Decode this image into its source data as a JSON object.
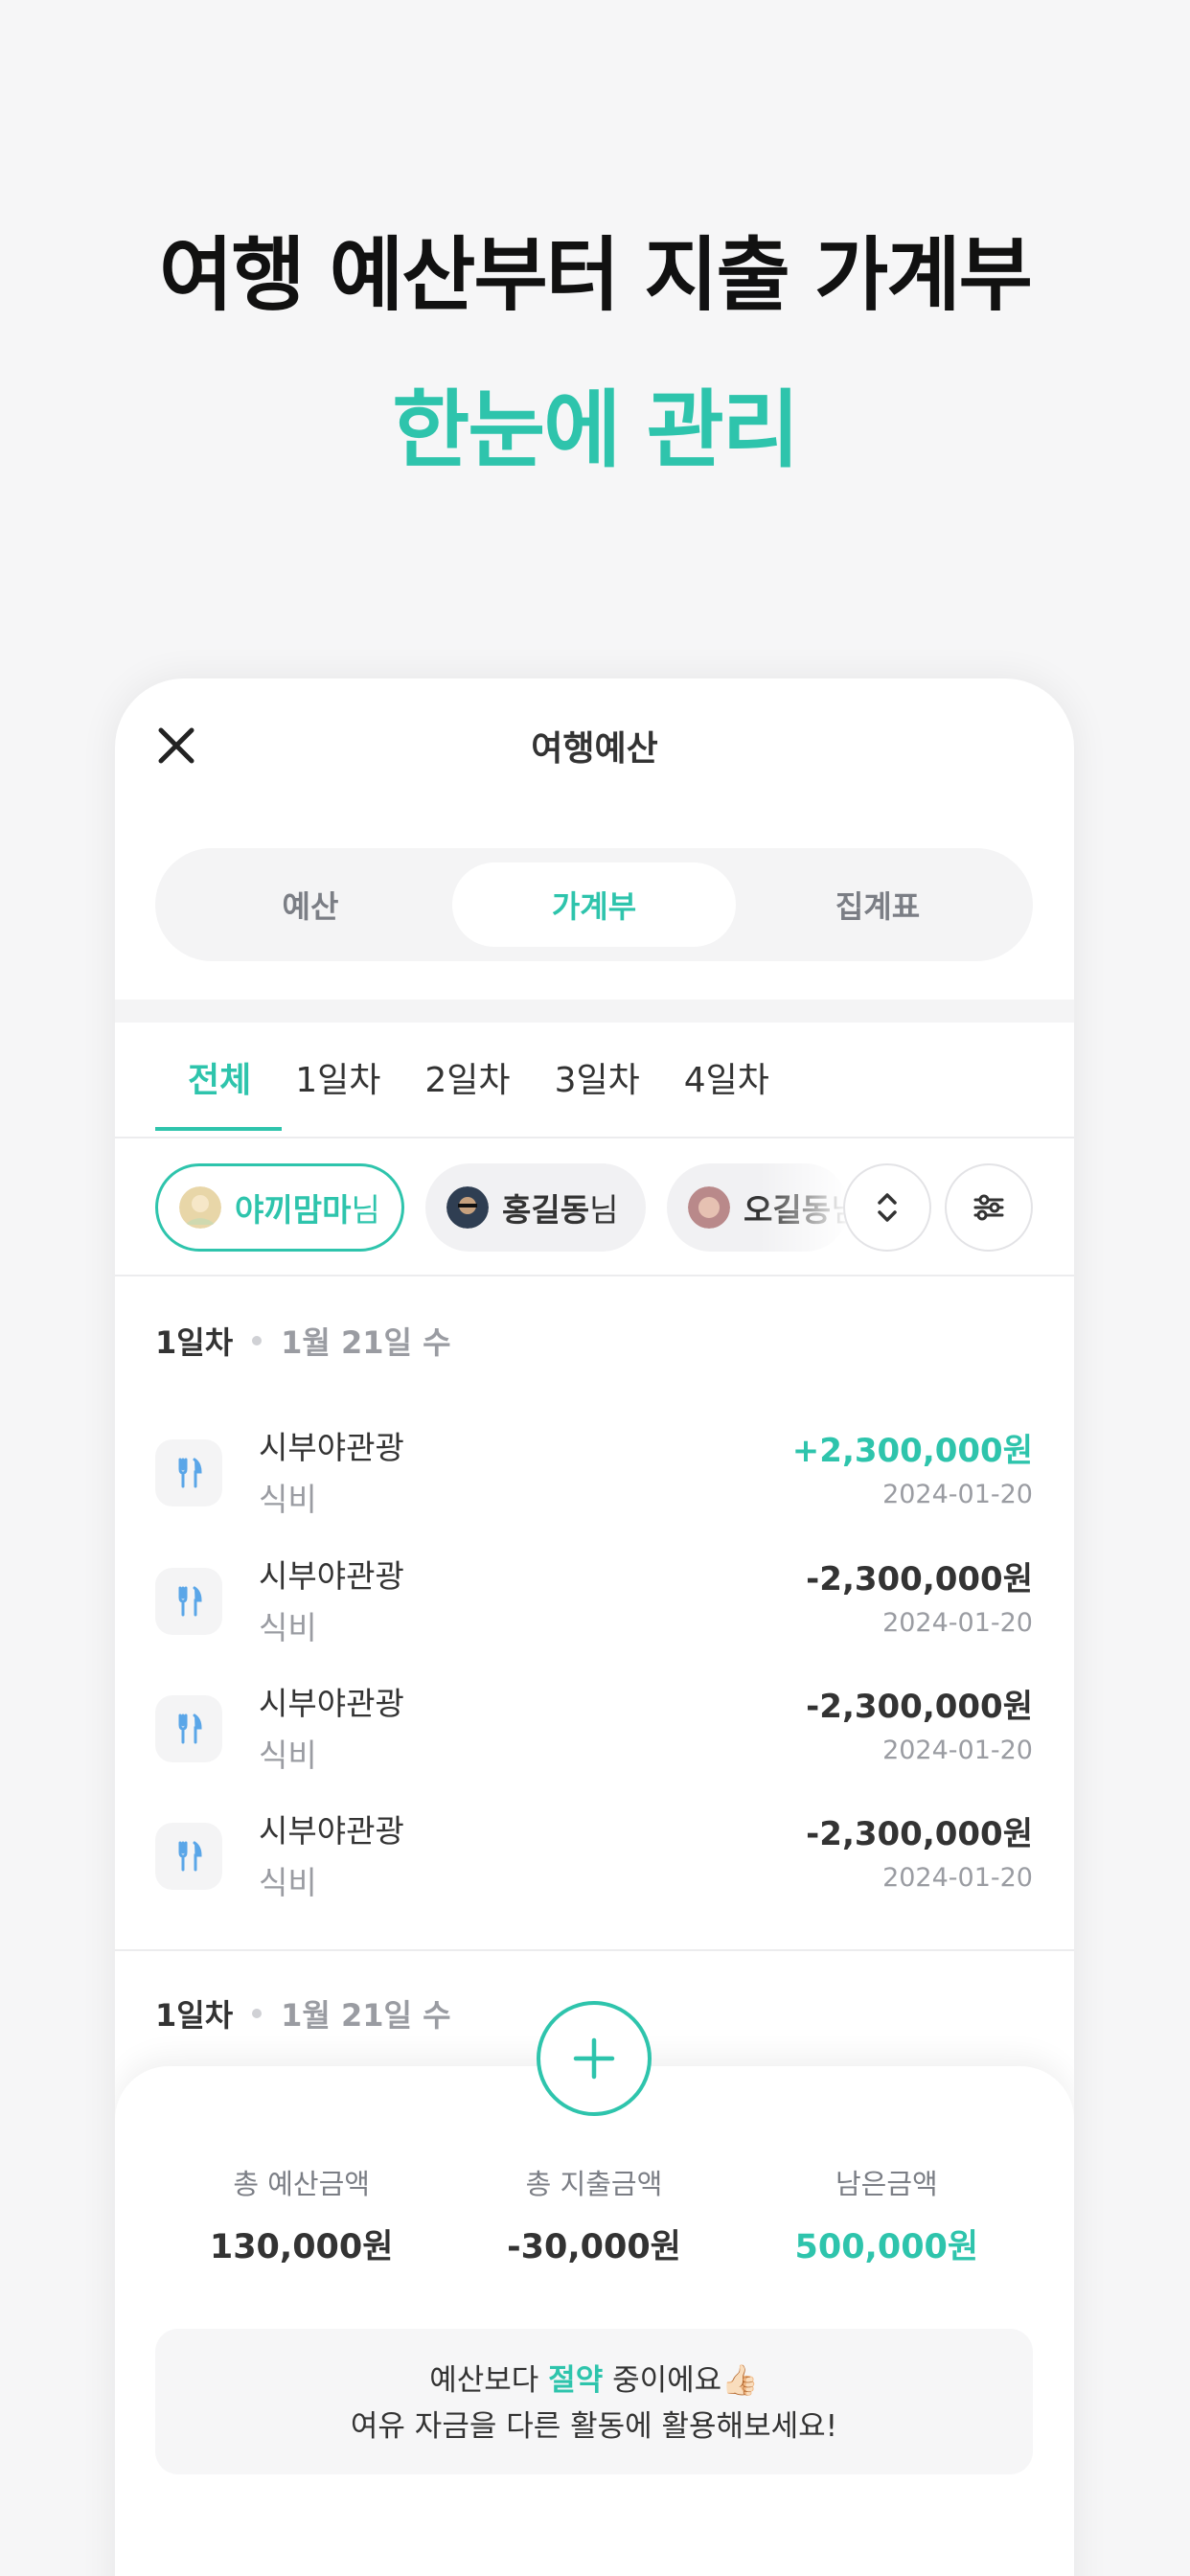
{
  "hero": {
    "line1": "여행 예산부터 지출 가계부",
    "line2": "한눈에 관리"
  },
  "colors": {
    "accent": "#2ec4ac",
    "text": "#333333",
    "muted": "#9a9ca2"
  },
  "header": {
    "title": "여행예산",
    "close_icon": "close-icon"
  },
  "segments": [
    {
      "label": "예산",
      "active": false
    },
    {
      "label": "가계부",
      "active": true
    },
    {
      "label": "집계표",
      "active": false
    }
  ],
  "day_tabs": [
    {
      "label": "전체",
      "active": true
    },
    {
      "label": "1일차",
      "active": false
    },
    {
      "label": "2일차",
      "active": false
    },
    {
      "label": "3일차",
      "active": false
    },
    {
      "label": "4일차",
      "active": false
    }
  ],
  "members": [
    {
      "name": "야끼맘마",
      "suffix": "님",
      "active": true
    },
    {
      "name": "홍길동",
      "suffix": "님",
      "active": false
    },
    {
      "name": "오길동",
      "suffix": "님",
      "active": false
    }
  ],
  "sections": [
    {
      "day": "1일차",
      "date": "1월 21일 수",
      "items": [
        {
          "name": "시부야관광",
          "category": "식비",
          "amount": "+2,300,000원",
          "date": "2024-01-20",
          "type": "plus"
        },
        {
          "name": "시부야관광",
          "category": "식비",
          "amount": "-2,300,000원",
          "date": "2024-01-20",
          "type": "minus"
        },
        {
          "name": "시부야관광",
          "category": "식비",
          "amount": "-2,300,000원",
          "date": "2024-01-20",
          "type": "minus"
        },
        {
          "name": "시부야관광",
          "category": "식비",
          "amount": "-2,300,000원",
          "date": "2024-01-20",
          "type": "minus"
        }
      ]
    },
    {
      "day": "1일차",
      "date": "1월 21일 수",
      "items": []
    }
  ],
  "summary": {
    "budget_label": "총 예산금액",
    "budget_value": "130,000원",
    "expense_label": "총 지출금액",
    "expense_value": "-30,000원",
    "remain_label": "남은금액",
    "remain_value": "500,000원"
  },
  "notice": {
    "pre": "예산보다 ",
    "highlight": "절약",
    "post": " 중이에요👍🏻",
    "line2": "여유 자금을 다른 활동에 활용해보세요!"
  }
}
